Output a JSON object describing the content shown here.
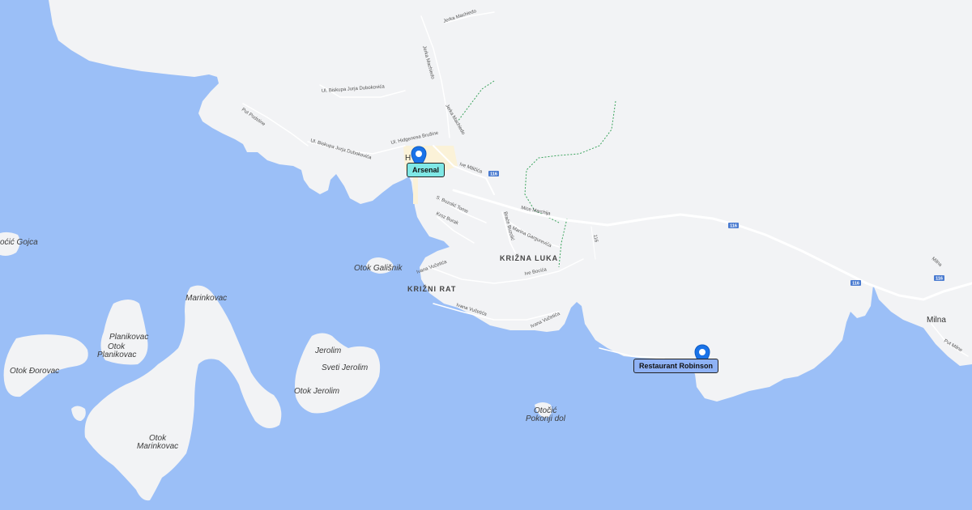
{
  "map": {
    "colors": {
      "water": "#9bbff7",
      "land": "#f2f3f5",
      "road": "#ffffff",
      "trail": "#3aa35c",
      "town_area": "#fbf2d8",
      "pin": "#1a73e8"
    },
    "markers": [
      {
        "id": "arsenal",
        "label": "Arsenal",
        "icon": "map-pin-icon"
      },
      {
        "id": "robinson",
        "label": "Restaurant Robinson",
        "icon": "map-pin-icon"
      }
    ],
    "islands": {
      "galisnik": "Otok Gališnik",
      "gojca": "oćić Gojca",
      "planikovac_a": "Planikovac",
      "planikovac_b1": "Otok",
      "planikovac_b2": "Planikovac",
      "borovac": "Otok Đorovac",
      "marinkovac_a": "Marinkovac",
      "marinkovac_b1": "Otok",
      "marinkovac_b2": "Marinkovac",
      "jerolim_a": "Jerolim",
      "jerolim_b": "Sveti Jerolim",
      "jerolim_c": "Otok Jerolim",
      "pokonji1": "Otočić",
      "pokonji2": "Pokonji dol"
    },
    "places": {
      "krizna_luka": "KRIŽNA LUKA",
      "krizni_rat": "KRIŽNI RAT",
      "milna": "Milna",
      "hvar_partial": "H"
    },
    "streets": {
      "biskupa1": "Ul. Biskupa Jurja Dubokovića",
      "biskupa2": "Ul. Biskupa Jurja Dubokovića",
      "put_podstine": "Put Podstine",
      "higgins": "Ul. Hidgenesa Brušine",
      "ive_milicica": "Ive Miličića",
      "mice": "Mice Marchija",
      "s_buzolic": "S. Buzolić Tome",
      "kroz_burak": "Kroz Burak",
      "brace": "Braće Buzolić",
      "marina": "Marina Gargurevića",
      "ive_bocica": "Ive Bocića",
      "ivana1": "Ivana Vučetića",
      "ivana2": "Ivana Vučetića",
      "ivana3": "Ivana Vučetića",
      "jerka1": "Jerka Machiedo",
      "jerka2": "Jerka Machiedo",
      "jerka3": "Jerka Machiedo",
      "put_milne": "Put Milne",
      "milna_road": "Milna"
    },
    "shields": {
      "s1": "116",
      "s2": "116",
      "s3": "116",
      "s4": "116",
      "s5": "116"
    }
  }
}
